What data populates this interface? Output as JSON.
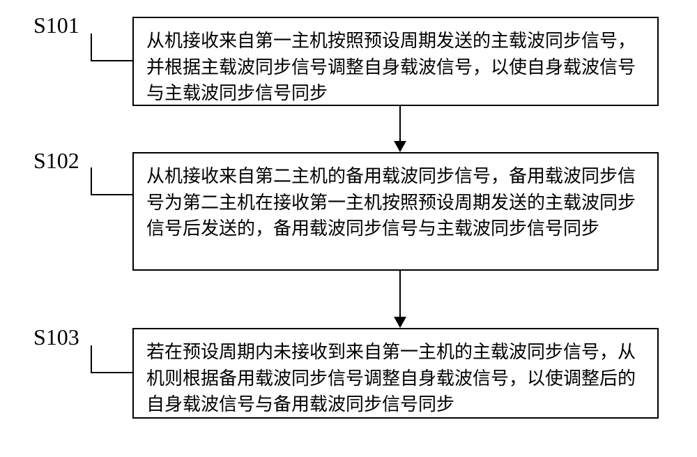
{
  "steps": [
    {
      "label": "S101",
      "text": "从机接收来自第一主机按照预设周期发送的主载波同步信号，并根据主载波同步信号调整自身载波信号，以使自身载波信号与主载波同步信号同步"
    },
    {
      "label": "S102",
      "text": "从机接收来自第二主机的备用载波同步信号，备用载波同步信号为第二主机在接收第一主机按照预设周期发送的主载波同步信号后发送的，备用载波同步信号与主载波同步信号同步"
    },
    {
      "label": "S103",
      "text": "若在预设周期内未接收到来自第一主机的主载波同步信号，从机则根据备用载波同步信号调整自身载波信号，以使调整后的自身载波信号与备用载波同步信号同步"
    }
  ]
}
